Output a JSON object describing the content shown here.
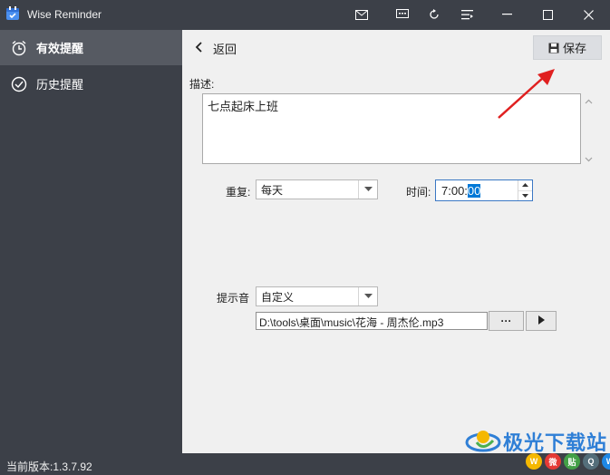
{
  "window": {
    "title": "Wise Reminder"
  },
  "sidebar": {
    "items": [
      {
        "label": "有效提醒",
        "icon": "alarm-clock-icon",
        "active": true
      },
      {
        "label": "历史提醒",
        "icon": "check-circle-icon",
        "active": false
      }
    ]
  },
  "header": {
    "back_label": "返回",
    "save_label": "保存"
  },
  "form": {
    "description_label": "描述:",
    "description_value": "七点起床上班",
    "repeat_label": "重复:",
    "repeat_value": "每天",
    "time_label": "时间:",
    "time_value_prefix": "7:00:",
    "time_value_selected": "00",
    "sound_label": "提示音",
    "sound_value": "自定义",
    "sound_path": "D:\\tools\\桌面\\music\\花海 - 周杰伦.mp3",
    "browse_label": "···"
  },
  "status": {
    "version": "当前版本:1.3.7.92"
  },
  "watermark": {
    "text": "极光下载站"
  },
  "colors": {
    "dark_bg": "#3c4048",
    "active_item": "#565a62",
    "content_bg": "#f0f0f0",
    "selection": "#0078d7",
    "arrow": "#e02020"
  }
}
